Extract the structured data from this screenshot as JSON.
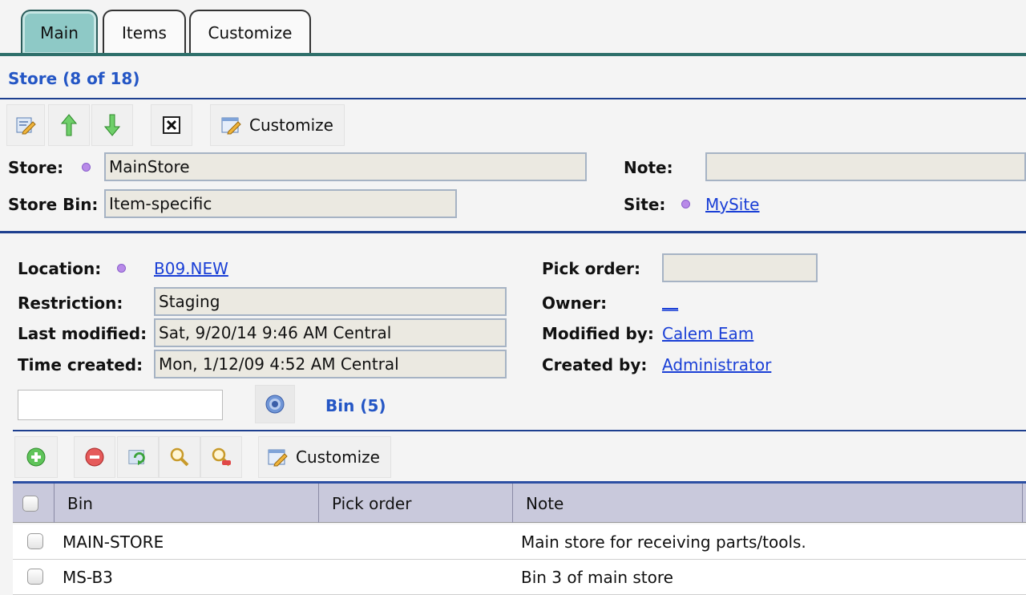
{
  "tabs": [
    {
      "label": "Main",
      "active": true
    },
    {
      "label": "Items",
      "active": false
    },
    {
      "label": "Customize",
      "active": false
    }
  ],
  "store_section": {
    "title": "Store (8 of 18)",
    "toolbar": {
      "customize_label": "Customize"
    },
    "fields": {
      "store_label": "Store:",
      "store_value": "MainStore",
      "note_label": "Note:",
      "note_value": "",
      "store_bin_label": "Store Bin:",
      "store_bin_value": "Item-specific",
      "site_label": "Site:",
      "site_value": "MySite"
    }
  },
  "detail": {
    "location_label": "Location:",
    "location_value": "B09.NEW",
    "pick_order_label": "Pick order:",
    "pick_order_value": "",
    "restriction_label": "Restriction:",
    "restriction_value": "Staging",
    "owner_label": "Owner:",
    "owner_value": "__",
    "last_modified_label": "Last modified:",
    "last_modified_value": "Sat, 9/20/14 9:46 AM Central",
    "modified_by_label": "Modified by:",
    "modified_by_value": "Calem Eam",
    "time_created_label": "Time created:",
    "time_created_value": "Mon, 1/12/09 4:52 AM Central",
    "created_by_label": "Created by:",
    "created_by_value": "Administrator"
  },
  "bin_section": {
    "search_value": "",
    "title": "Bin (5)",
    "toolbar": {
      "customize_label": "Customize"
    },
    "columns": [
      "Bin",
      "Pick order",
      "Note"
    ],
    "rows": [
      {
        "bin": "MAIN-STORE",
        "pick_order": "",
        "note": "Main store for receiving parts/tools."
      },
      {
        "bin": "MS-B3",
        "pick_order": "",
        "note": "Bin 3 of main store"
      }
    ]
  },
  "colors": {
    "accent_blue": "#2456c5",
    "active_tab": "#8ec9c6",
    "link": "#1a3fd6",
    "field_bg": "#ebe9e1"
  },
  "icons": [
    "edit-icon",
    "move-up-icon",
    "move-down-icon",
    "close-icon",
    "customize-icon",
    "help-icon",
    "add-icon",
    "remove-icon",
    "refresh-icon",
    "search-icon",
    "clear-search-icon"
  ]
}
